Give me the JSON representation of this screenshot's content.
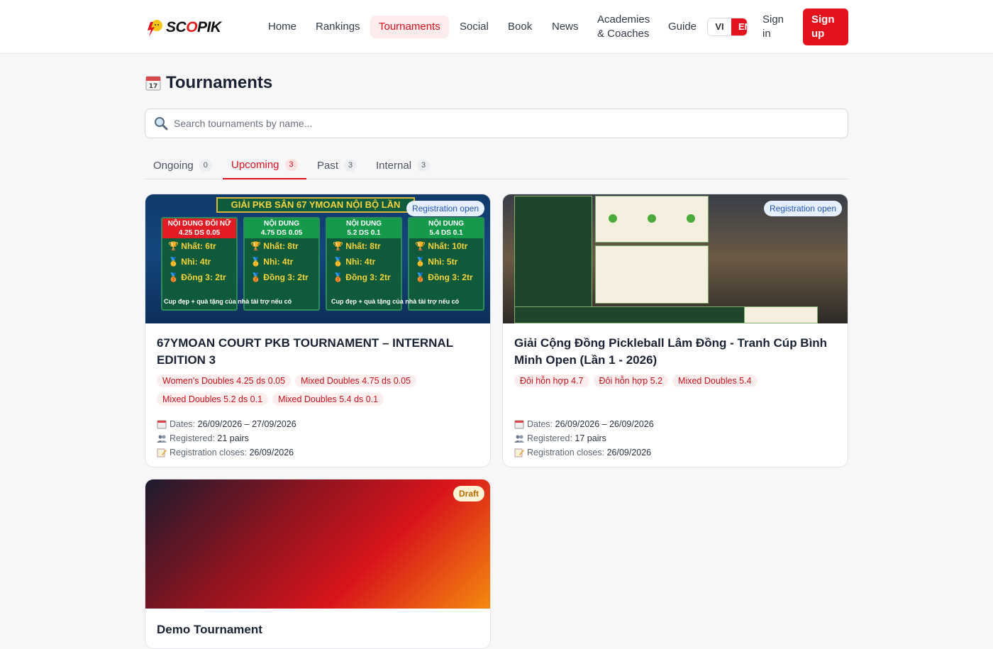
{
  "header": {
    "logo_text_a": "SC",
    "logo_text_o": "O",
    "logo_text_b": "PIK",
    "nav": {
      "home": "Home",
      "rankings": "Rankings",
      "tournaments": "Tournaments",
      "social": "Social",
      "book": "Book",
      "news": "News",
      "academies_1": "Academies",
      "academies_2": "& Coaches",
      "guide": "Guide"
    },
    "lang_vi": "VI",
    "lang_en": "EN",
    "sign_in_1": "Sign",
    "sign_in_2": "in",
    "sign_up_1": "Sign",
    "sign_up_2": "up"
  },
  "page_title": "Tournaments",
  "search": {
    "placeholder": "Search tournaments by name..."
  },
  "tabs": [
    {
      "label": "Ongoing",
      "count": "0"
    },
    {
      "label": "Upcoming",
      "count": "3"
    },
    {
      "label": "Past",
      "count": "3"
    },
    {
      "label": "Internal",
      "count": "3"
    }
  ],
  "meta_labels": {
    "dates": "Dates:",
    "registered": "Registered:",
    "closes": "Registration closes:"
  },
  "cards": [
    {
      "badge": "Registration open",
      "title": "67YMOAN COURT PKB TOURNAMENT – INTERNAL EDITION 3",
      "chips": [
        "Women's Doubles 4.25 ds 0.05",
        "Mixed Doubles 4.75 ds 0.05",
        "Mixed Doubles 5.2 ds 0.1",
        "Mixed Doubles 5.4 ds 0.1"
      ],
      "dates": "26/09/2026 – 27/09/2026",
      "registered": "21 pairs",
      "closes": "26/09/2026",
      "poster": {
        "banner": "GIẢI PKB SÂN 67 YMOAN NỘI BỘ LẦN",
        "boxes": [
          {
            "h1": "NỘI DUNG ĐÔI NỮ",
            "h2": "4.25 DS 0.05",
            "l1": "🏆 Nhất: 6tr",
            "l2": "🥇 Nhì: 4tr",
            "l3": "🥉 Đồng 3: 2tr"
          },
          {
            "h1": "NỘI DUNG",
            "h2": "4.75 DS 0.05",
            "l1": "🏆 Nhất: 8tr",
            "l2": "🥇 Nhì: 4tr",
            "l3": "🥉 Đồng 3: 2tr"
          },
          {
            "h1": "NỘI DUNG",
            "h2": "5.2 DS 0.1",
            "l1": "🏆 Nhất: 8tr",
            "l2": "🥇 Nhì: 4tr",
            "l3": "🥉 Đồng 3: 2tr"
          },
          {
            "h1": "NỘI DUNG",
            "h2": "5.4 DS 0.1",
            "l1": "🏆 Nhất: 10tr",
            "l2": "🥇 Nhì: 5tr",
            "l3": "🥉 Đồng 3: 2tr"
          }
        ],
        "foot_a": "Cup đẹp + quà tặng của nhà tài trợ nếu có",
        "foot_b": "Cup đẹp + quà tặng của nhà tài trợ nếu có"
      }
    },
    {
      "badge": "Registration open",
      "title": "Giải Cộng Đồng Pickleball Lâm Đồng - Tranh Cúp Bình Minh Open (Lần 1 - 2026)",
      "chips": [
        "Đôi hỗn hợp 4.7",
        "Đôi hỗn hợp 5.2",
        "Mixed Doubles 5.4"
      ],
      "dates": "26/09/2026 – 26/09/2026",
      "registered": "17 pairs",
      "closes": "26/09/2026"
    },
    {
      "badge": "Draft",
      "title": "Demo Tournament"
    }
  ],
  "colors": {
    "brand_red": "#e4121d",
    "active_tab": "#d8101f",
    "open_badge": "#2453b8",
    "draft_badge": "#b86b00"
  }
}
